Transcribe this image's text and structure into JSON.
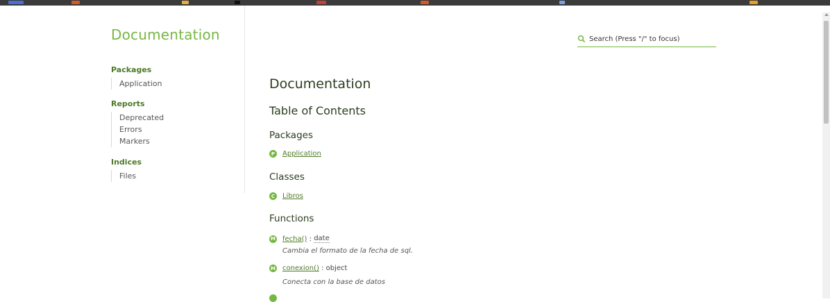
{
  "sidebar": {
    "brand": "Documentation",
    "sections": [
      {
        "heading": "Packages",
        "items": [
          "Application"
        ]
      },
      {
        "heading": "Reports",
        "items": [
          "Deprecated",
          "Errors",
          "Markers"
        ]
      },
      {
        "heading": "Indices",
        "items": [
          "Files"
        ]
      }
    ]
  },
  "search": {
    "placeholder": "Search (Press \"/\" to focus)"
  },
  "main": {
    "title": "Documentation",
    "toc_title": "Table of Contents",
    "packages": {
      "heading": "Packages",
      "items": [
        {
          "badge": "P",
          "name": "Application"
        }
      ]
    },
    "classes": {
      "heading": "Classes",
      "items": [
        {
          "badge": "C",
          "name": "Libros"
        }
      ]
    },
    "functions": {
      "heading": "Functions",
      "items": [
        {
          "badge": "M",
          "name": "fecha()",
          "sep": " : ",
          "type": "date",
          "description": "Cambia el formato de la fecha de sql."
        },
        {
          "badge": "M",
          "name": "conexion()",
          "sep": " : ",
          "type": "object",
          "description": "Conecta con la base de datos"
        }
      ]
    }
  },
  "colors": {
    "accent": "#76b743",
    "heading": "#2a3d1f",
    "link": "#4e7a27"
  }
}
